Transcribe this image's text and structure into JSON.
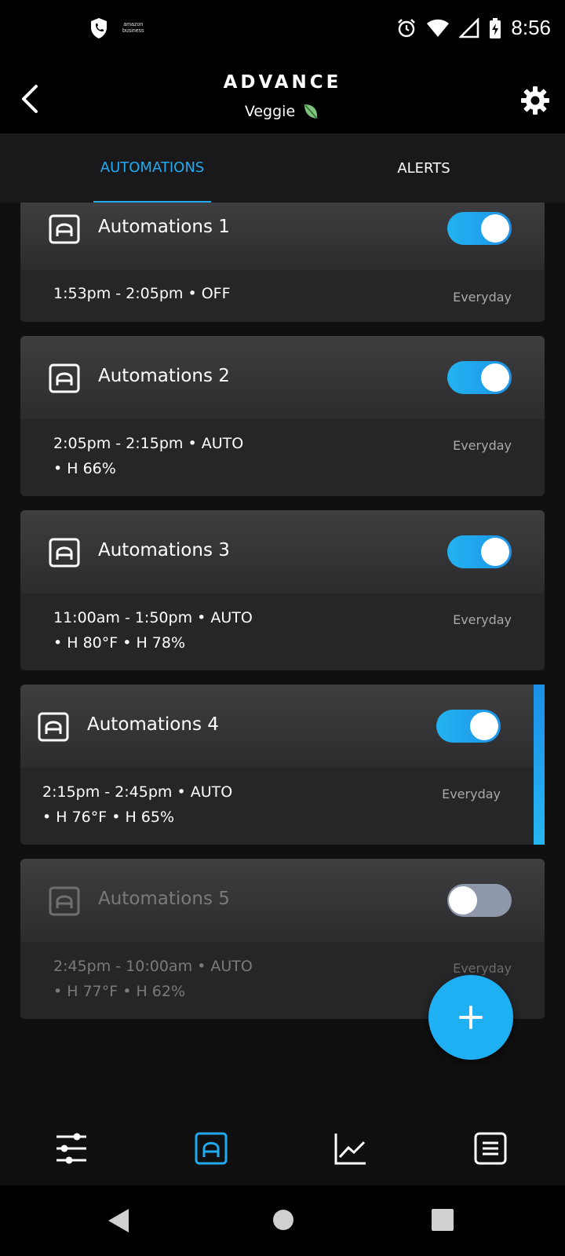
{
  "status_bar": {
    "time": "8:56",
    "amazon_line1": "amazon",
    "amazon_line2": "business"
  },
  "header": {
    "title": "ADVANCE",
    "subtitle": "Veggie"
  },
  "tabs": [
    {
      "label": "AUTOMATIONS",
      "active": true
    },
    {
      "label": "ALERTS",
      "active": false
    }
  ],
  "automations": [
    {
      "name": "Automations 1",
      "line1": "1:53pm - 2:05pm • OFF",
      "line2": "",
      "days": "Everyday",
      "enabled": true
    },
    {
      "name": "Automations 2",
      "line1": "2:05pm - 2:15pm • AUTO",
      "line2": "• H 66%",
      "days": "Everyday",
      "enabled": true
    },
    {
      "name": "Automations 3",
      "line1": "11:00am - 1:50pm • AUTO",
      "line2": "• H 80°F • H 78%",
      "days": "Everyday",
      "enabled": true
    },
    {
      "name": "Automations 4",
      "line1": "2:15pm - 2:45pm • AUTO",
      "line2": "• H 76°F • H 65%",
      "days": "Everyday",
      "enabled": true
    },
    {
      "name": "Automations 5",
      "line1": "2:45pm - 10:00am • AUTO",
      "line2": "• H 77°F • H 62%",
      "days": "Everyday",
      "enabled": false
    }
  ],
  "colors": {
    "accent": "#21aaf0",
    "background": "#101011",
    "card": "#262628",
    "toggle_off": "#8f98ab"
  },
  "icons": {
    "back": "chevron-left-icon",
    "settings": "gear-icon",
    "leaf": "leaf-icon",
    "add": "plus-icon",
    "nav": [
      "sliders-icon",
      "automation-icon",
      "chart-line-icon",
      "list-icon"
    ]
  }
}
